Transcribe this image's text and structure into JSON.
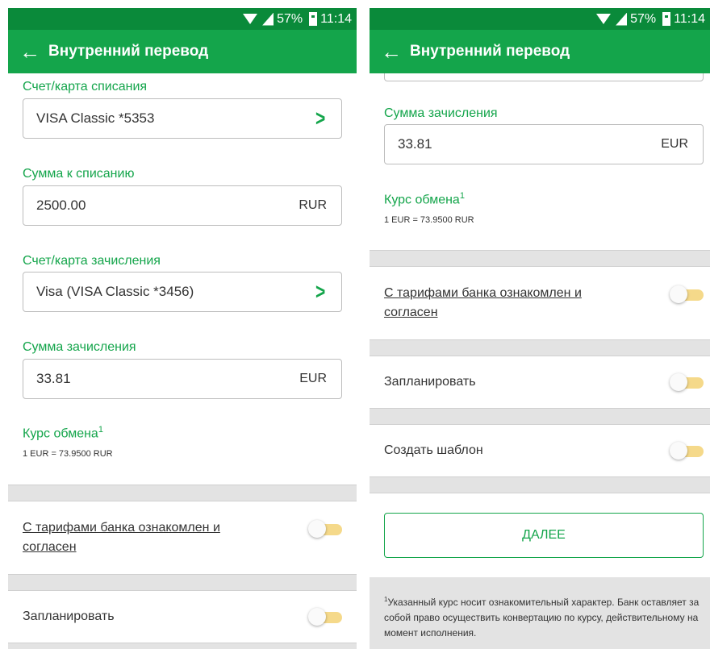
{
  "status_bar": {
    "battery": "57%",
    "time": "11:14"
  },
  "app_bar": {
    "title": "Внутренний перевод"
  },
  "form": {
    "debit_account_label": "Счет/карта списания",
    "debit_account_value": "VISA Classic *5353",
    "debit_amount_label": "Сумма к списанию",
    "debit_amount_value": "2500.00",
    "debit_currency": "RUR",
    "credit_account_label": "Счет/карта зачисления",
    "credit_account_value": "Visa (VISA Classic *3456)",
    "credit_amount_label": "Сумма зачисления",
    "credit_amount_value": "33.81",
    "credit_currency": "EUR",
    "rate_label": "Курс обмена",
    "rate_footnote_mark": "1",
    "rate_value": "1 EUR = 73.9500 RUR"
  },
  "toggles": {
    "tariffs_line1": "С тарифами банка ознакомлен и",
    "tariffs_line2": "согласен",
    "tariffs_on": false,
    "schedule": "Запланировать",
    "schedule_on": false,
    "template": "Создать шаблон",
    "template_on": false
  },
  "next_button": "ДАЛЕЕ",
  "footnote": {
    "mark": "1",
    "text": "Указанный курс носит ознакомительный характер. Банк оставляет за собой право осуществить конвертацию по курсу, действительному на момент исполнения."
  },
  "colors": {
    "status_bar": "#0a8a3a",
    "app_bar": "#14a54b",
    "accent": "#14a54b",
    "toggle_track": "#f5d98a",
    "separator": "#e3e3e3"
  },
  "icons": {
    "back": "arrow-left-icon",
    "chevron": "chevron-right-icon",
    "wifi": "wifi-icon",
    "sim": "no-sim-icon",
    "battery": "battery-icon"
  }
}
